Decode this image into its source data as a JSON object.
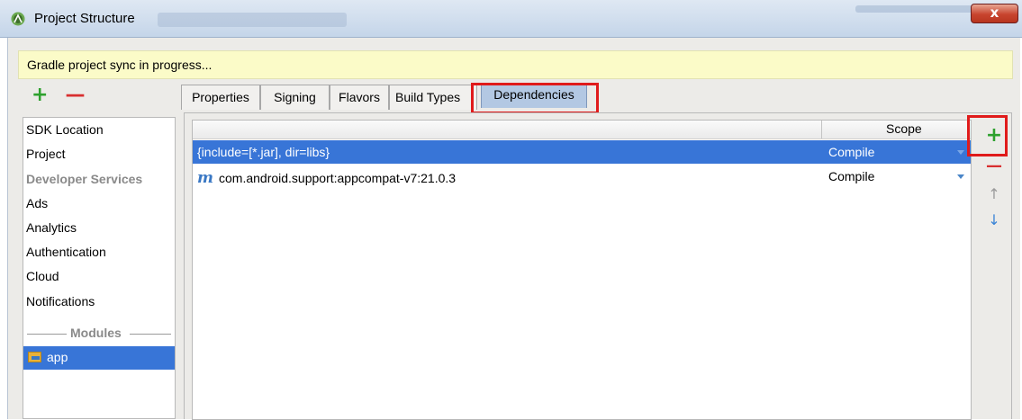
{
  "window": {
    "title": "Project Structure",
    "close_label": "x"
  },
  "banner": {
    "text": "Gradle project sync in progress..."
  },
  "toolbar": {
    "add_symbol": "+",
    "remove_symbol": "—"
  },
  "sidebar": {
    "items": [
      {
        "label": "SDK Location",
        "section": false
      },
      {
        "label": "Project",
        "section": false
      },
      {
        "label": "Developer Services",
        "section": true
      },
      {
        "label": "Ads",
        "section": false
      },
      {
        "label": "Analytics",
        "section": false
      },
      {
        "label": "Authentication",
        "section": false
      },
      {
        "label": "Cloud",
        "section": false
      },
      {
        "label": "Notifications",
        "section": false
      }
    ],
    "modules_label": "Modules",
    "module": {
      "label": "app",
      "selected": true
    }
  },
  "tabs": [
    {
      "label": "Properties",
      "active": false
    },
    {
      "label": "Signing",
      "active": false
    },
    {
      "label": "Flavors",
      "active": false
    },
    {
      "label": "Build Types",
      "active": false
    },
    {
      "label": "Dependencies",
      "active": true
    }
  ],
  "table": {
    "columns": [
      "",
      "Scope"
    ],
    "rows": [
      {
        "name": "{include=[*.jar], dir=libs}",
        "scope": "Compile",
        "selected": true,
        "icon": ""
      },
      {
        "name": "com.android.support:appcompat-v7:21.0.3",
        "scope": "Compile",
        "selected": false,
        "icon": "m"
      }
    ]
  },
  "side_tools": {
    "add": "+",
    "remove": "—",
    "up": "↑",
    "down": "↓"
  },
  "colors": {
    "selection": "#3875d7",
    "banner": "#fbfbc8",
    "add": "#2ea12e",
    "remove": "#d82f2f",
    "highlight_box": "#e01b1b"
  }
}
